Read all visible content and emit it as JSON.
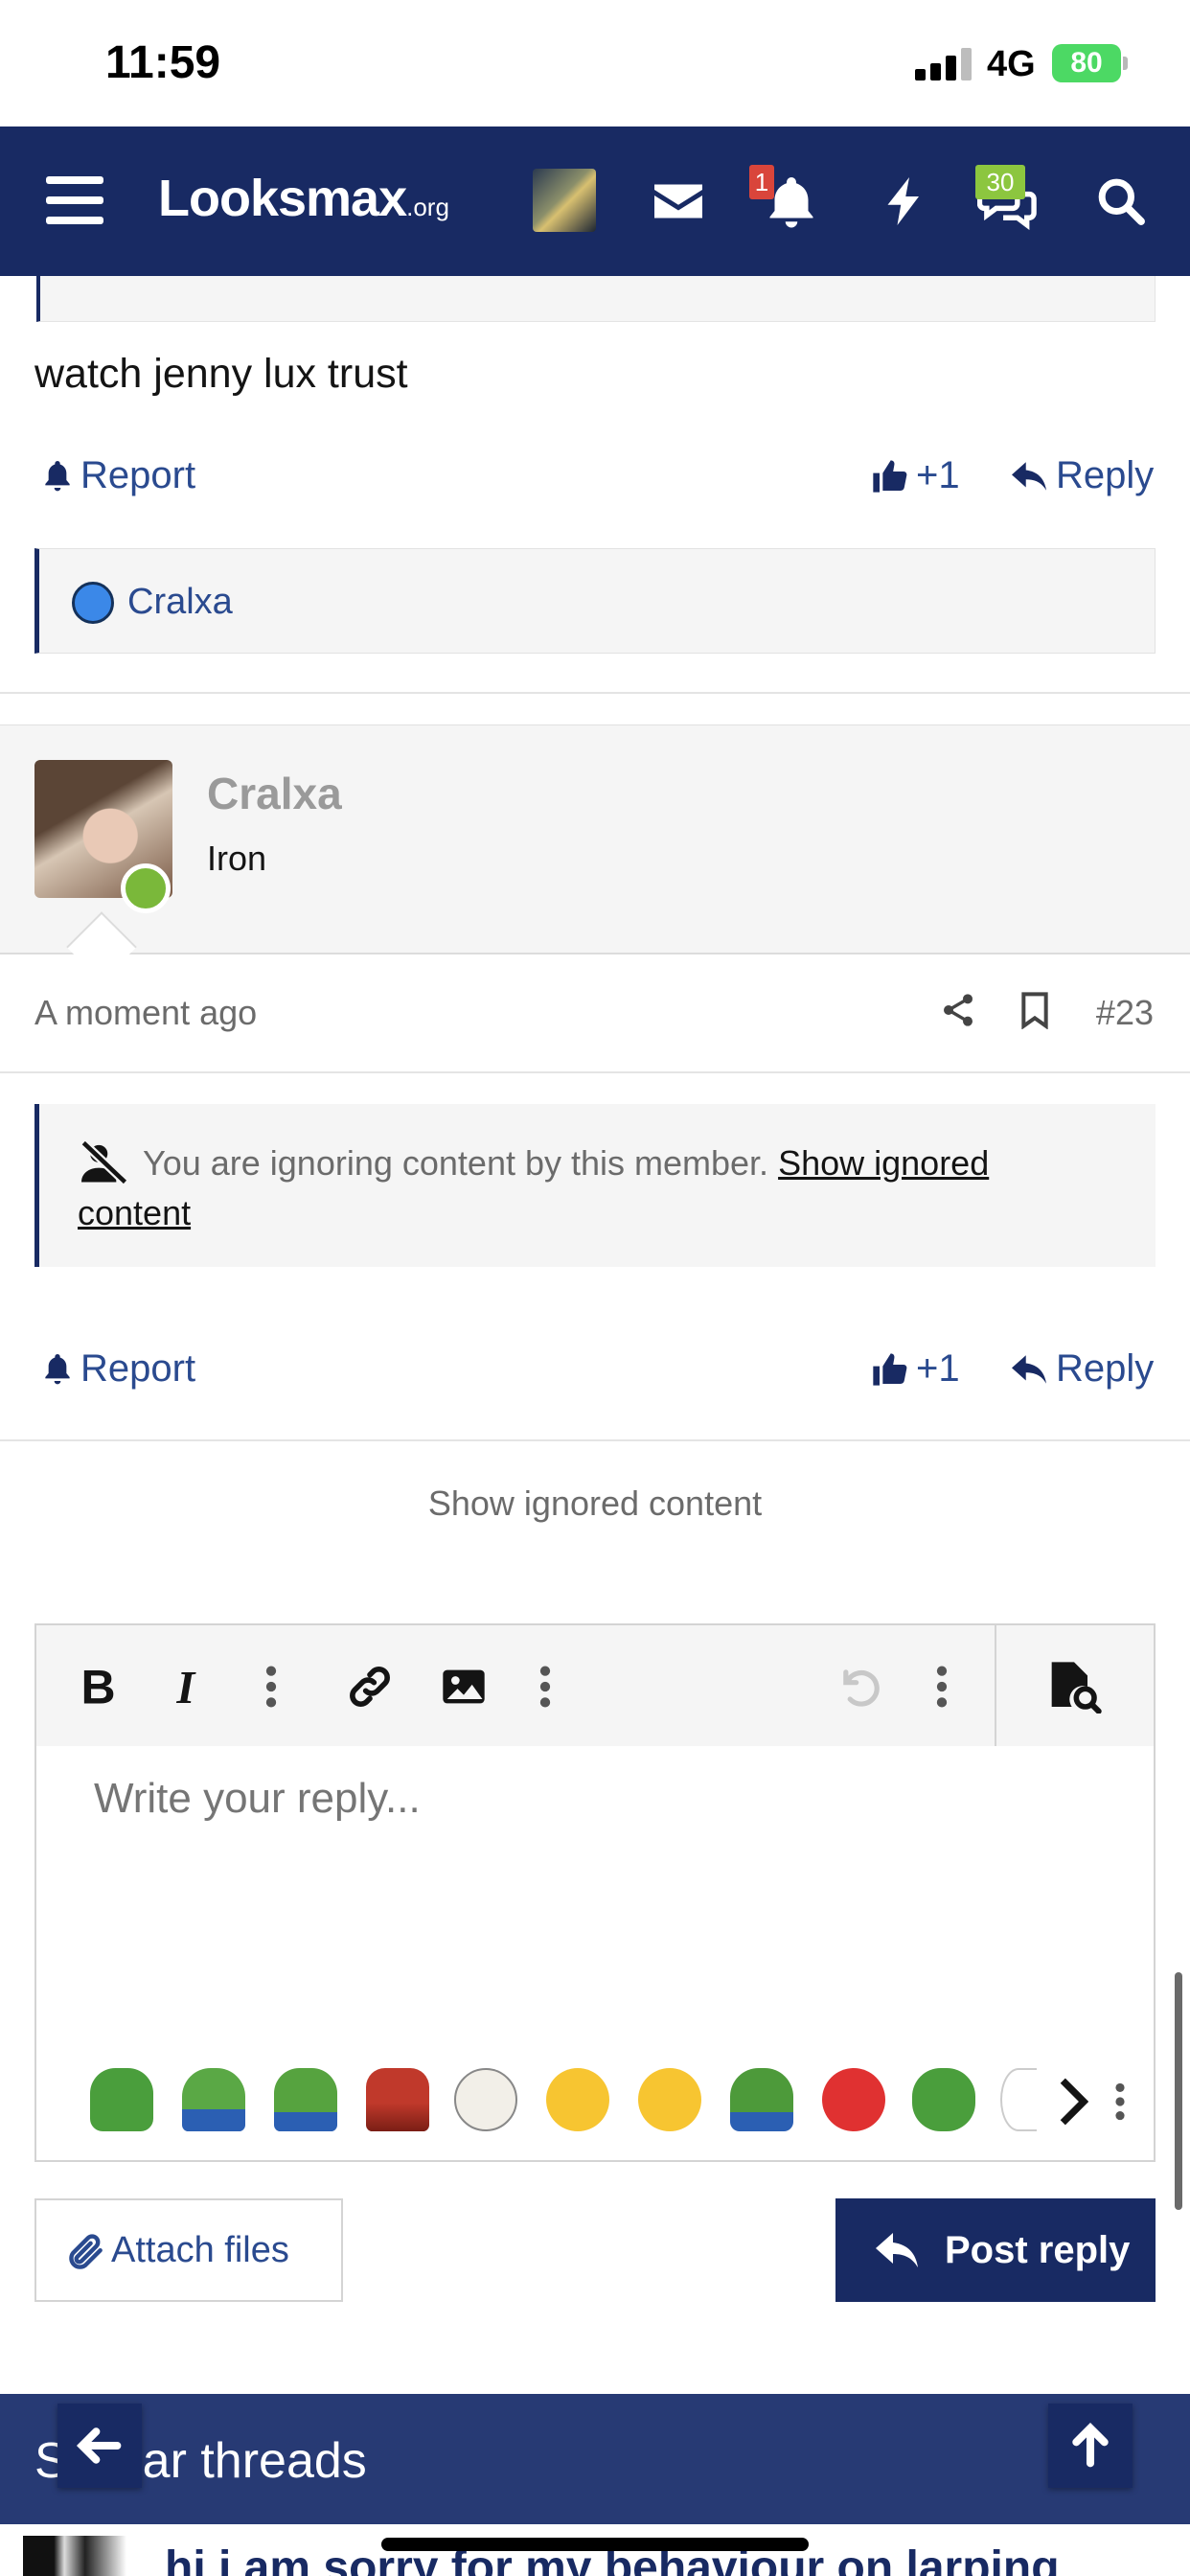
{
  "status_bar": {
    "time": "11:59",
    "network": "4G",
    "battery": "80"
  },
  "nav": {
    "logo_main": "Looksmax",
    "logo_suffix": ".org",
    "alerts_count": "1",
    "conversations_count": "30"
  },
  "previous_post": {
    "text": "watch jenny lux trust",
    "report_label": "Report",
    "like_label": "+1",
    "reply_label": "Reply",
    "reactions": [
      {
        "user": "Cralxa"
      }
    ]
  },
  "post": {
    "author": "Cralxa",
    "user_title": "Iron",
    "time": "A moment ago",
    "number": "#23",
    "ignored_notice": "You are ignoring content by this member.",
    "ignored_link_line1": "Show ignored",
    "ignored_link_line2": "content",
    "report_label": "Report",
    "like_label": "+1",
    "reply_label": "Reply"
  },
  "show_ignored_content": "Show ignored content",
  "editor": {
    "placeholder": "Write your reply...",
    "smilies": [
      "pepe-grin",
      "pepe-sad",
      "pepe-smug",
      "pepe-devil",
      "wojak-cry",
      "emoji-laugh-cry",
      "emoji-confused",
      "pepe-think",
      "emoji-angry",
      "pepe-happy",
      "wojak-outline"
    ]
  },
  "buttons": {
    "attach": "Attach files",
    "post_reply": "Post reply"
  },
  "similar_threads": {
    "title": "Similar threads",
    "first_thread": "hi i am sorry for my behaviour on larping"
  },
  "colors": {
    "brand": "#182a63",
    "link": "#2a4a8f",
    "online": "#7ab83a"
  }
}
